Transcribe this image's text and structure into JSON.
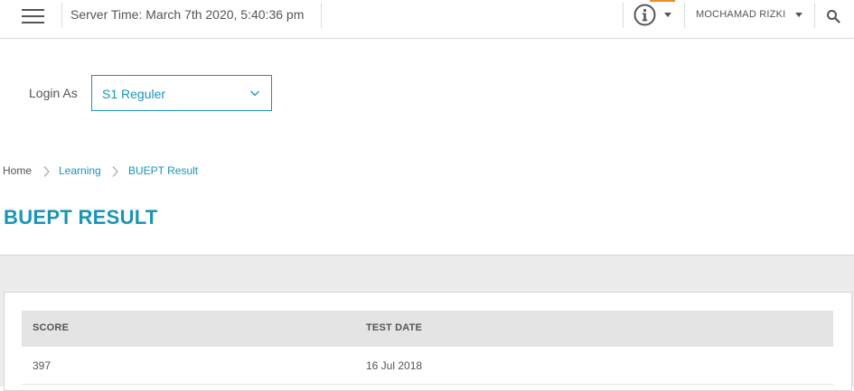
{
  "header": {
    "server_time": "Server Time: March 7th 2020, 5:40:36 pm",
    "user_name": "MOCHAMAD RIZKI",
    "accent_color": "#1a94b8",
    "badge_color": "#f08c2a",
    "icons": [
      "hamburger-menu-icon",
      "info-icon",
      "caret-down-icon",
      "search-icon"
    ]
  },
  "login": {
    "label": "Login As",
    "selected": "S1 Reguler"
  },
  "breadcrumb": {
    "home": "Home",
    "learning": "Learning",
    "current": "BUEPT Result"
  },
  "page": {
    "title": "BUEPT RESULT"
  },
  "table": {
    "columns": [
      "SCORE",
      "TEST DATE"
    ],
    "rows": [
      {
        "score": "397",
        "test_date": "16 Jul 2018"
      }
    ]
  }
}
